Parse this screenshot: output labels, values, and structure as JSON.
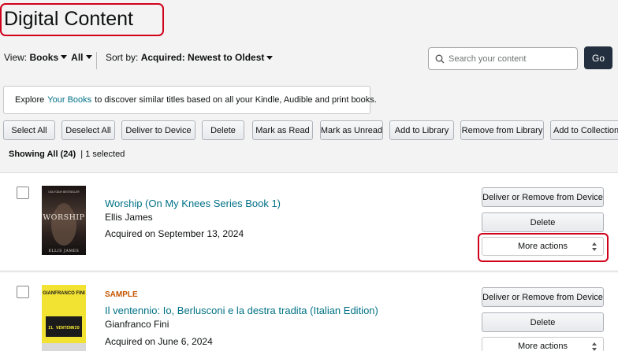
{
  "page": {
    "title": "Digital Content"
  },
  "view": {
    "label": "View:",
    "type_value": "Books",
    "filter_value": "All"
  },
  "sort": {
    "label": "Sort by:",
    "value": "Acquired: Newest to Oldest"
  },
  "search": {
    "placeholder": "Search your content",
    "go_label": "Go"
  },
  "explore": {
    "prefix": "Explore",
    "link": "Your Books",
    "suffix": "to discover similar titles based on all your Kindle, Audible and print books."
  },
  "toolbar": {
    "buttons": [
      "Select All",
      "Deselect All",
      "Deliver to Device",
      "Delete",
      "Mark as Read",
      "Mark as Unread",
      "Add to Library",
      "Remove from Library",
      "Add to Collections"
    ]
  },
  "status": {
    "showing": "Showing All (24)",
    "selected": "| 1 selected"
  },
  "items": [
    {
      "badge": "",
      "title": "Worship (On My Knees Series Book 1)",
      "author": "Ellis James",
      "acquired": "Acquired on September 13, 2024",
      "cover_top": "USA TODAY BESTSELLER",
      "cover_title": "WORSHIP",
      "cover_author": "ELLIS JAMES",
      "actions": {
        "deliver": "Deliver or Remove from Device",
        "delete": "Delete",
        "more": "More actions"
      }
    },
    {
      "badge": "SAMPLE",
      "title": "Il ventennio: Io, Berlusconi e la destra tradita (Italian Edition)",
      "author": "Gianfranco Fini",
      "acquired": "Acquired on June 6, 2024",
      "cover_top": "GIANFRANCO FINI",
      "cover_title": "IL VENTENNIO",
      "cover_author": "",
      "actions": {
        "deliver": "Deliver or Remove from Device",
        "delete": "Delete",
        "more": "More actions"
      }
    }
  ],
  "colors": {
    "link": "#007185",
    "highlight": "#d0021b",
    "go_button": "#232f3e",
    "sample_badge": "#c45500"
  }
}
